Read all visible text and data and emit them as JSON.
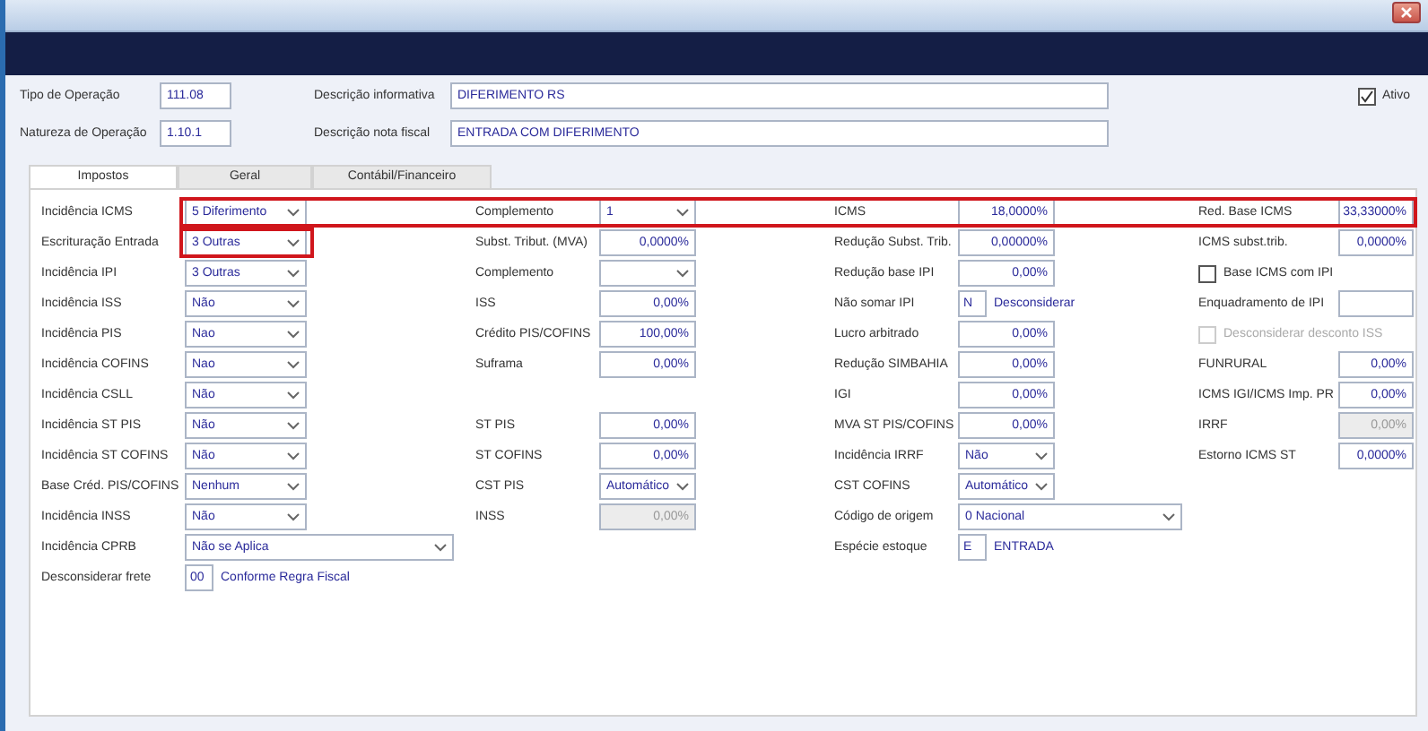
{
  "header_rows": [
    {
      "code_label": "Tipo de Operação",
      "code": "111.08",
      "description_label": "Descrição informativa",
      "description": "DIFERIMENTO RS"
    },
    {
      "code_label": "Natureza de Operação",
      "code": "1.10.1",
      "description_label": "Descrição nota fiscal",
      "description": "ENTRADA COM DIFERIMENTO"
    }
  ],
  "active": {
    "label": "Ativo",
    "checked": true
  },
  "tabs": [
    {
      "label": "Impostos",
      "selected": true
    },
    {
      "label": "Geral",
      "selected": false
    },
    {
      "label": "Contábil/Financeiro",
      "selected": false
    }
  ],
  "rows": [
    {
      "highlighted": true,
      "left": {
        "kind": "select",
        "label": "Incidência ICMS",
        "value": "5 Diferimento"
      },
      "center_left": {
        "kind": "select",
        "label": "Complemento",
        "value": "1"
      },
      "center_right": {
        "kind": "percent",
        "label": "ICMS",
        "value": "18,0000%",
        "disabled": false
      },
      "right": {
        "kind": "percent",
        "label": "Red. Base ICMS",
        "value": "33,33000%",
        "disabled": false
      }
    },
    {
      "left": {
        "kind": "select",
        "label": "Escrituração Entrada",
        "value": "3 Outras",
        "highlighted": true
      },
      "center_left": {
        "kind": "percent",
        "label": "Subst. Tribut. (MVA)",
        "value": "0,0000%",
        "disabled": false
      },
      "center_right": {
        "kind": "percent",
        "label": "Redução Subst. Trib.",
        "value": "0,00000%",
        "disabled": false
      },
      "right": {
        "kind": "percent",
        "label": "ICMS subst.trib.",
        "value": "0,0000%",
        "disabled": false
      }
    },
    {
      "left": {
        "kind": "select",
        "label": "Incidência IPI",
        "value": "3 Outras"
      },
      "center_left": {
        "kind": "select",
        "label": "Complemento"
      },
      "center_right": {
        "kind": "percent",
        "label": "Redução base IPI",
        "value": "0,00%",
        "disabled": false
      },
      "right": {
        "kind": "checkbox",
        "label": "Base ICMS com IPI",
        "checked": false,
        "disabled": false
      }
    },
    {
      "left": {
        "kind": "select",
        "label": "Incidência ISS",
        "value": "Não"
      },
      "center_left": {
        "kind": "percent",
        "label": "ISS",
        "value": "0,00%",
        "disabled": false
      },
      "center_right": {
        "kind": "code",
        "label": "Não somar IPI",
        "code": "N",
        "text": "Desconsiderar"
      },
      "right": {
        "kind": "text",
        "label": "Enquadramento de IPI"
      }
    },
    {
      "left": {
        "kind": "select",
        "label": "Incidência PIS",
        "value": "Nao"
      },
      "center_left": {
        "kind": "percent",
        "label": "Crédito PIS/COFINS",
        "value": "100,00%",
        "disabled": false
      },
      "center_right": {
        "kind": "percent",
        "label": "Lucro arbitrado",
        "value": "0,00%",
        "disabled": false
      },
      "right": {
        "kind": "checkbox",
        "label": "Desconsiderar desconto ISS",
        "checked": false,
        "disabled": true
      }
    },
    {
      "left": {
        "kind": "select",
        "label": "Incidência COFINS",
        "value": "Nao"
      },
      "center_left": {
        "kind": "percent",
        "label": "Suframa",
        "value": "0,00%",
        "disabled": false
      },
      "center_right": {
        "kind": "percent",
        "label": "Redução SIMBAHIA",
        "value": "0,00%",
        "disabled": false
      },
      "right": {
        "kind": "percent",
        "label": "FUNRURAL",
        "value": "0,00%",
        "disabled": false
      }
    },
    {
      "left": {
        "kind": "select",
        "label": "Incidência CSLL",
        "value": "Não"
      },
      "center_right": {
        "kind": "percent",
        "label": "IGI",
        "value": "0,00%",
        "disabled": false
      },
      "right": {
        "kind": "percent",
        "label": "ICMS IGI/ICMS Imp. PR",
        "value": "0,00%",
        "disabled": false
      }
    },
    {
      "left": {
        "kind": "select",
        "label": "Incidência ST PIS",
        "value": "Não"
      },
      "center_left": {
        "kind": "percent",
        "label": "ST PIS",
        "value": "0,00%",
        "disabled": false
      },
      "center_right": {
        "kind": "percent",
        "label": "MVA ST PIS/COFINS",
        "value": "0,00%",
        "disabled": false
      },
      "right": {
        "kind": "percent",
        "label": "IRRF",
        "value": "0,00%",
        "disabled": true
      }
    },
    {
      "left": {
        "kind": "select",
        "label": "Incidência ST COFINS",
        "value": "Não"
      },
      "center_left": {
        "kind": "percent",
        "label": "ST COFINS",
        "value": "0,00%",
        "disabled": false
      },
      "center_right": {
        "kind": "select",
        "label": "Incidência IRRF",
        "value": "Não"
      },
      "right": {
        "kind": "percent",
        "label": "Estorno ICMS ST",
        "value": "0,0000%",
        "disabled": false
      }
    },
    {
      "left": {
        "kind": "select",
        "label": "Base Créd. PIS/COFINS",
        "value": "Nenhum"
      },
      "center_left": {
        "kind": "select",
        "label": "CST PIS",
        "value": "Automático"
      },
      "center_right": {
        "kind": "select",
        "label": "CST COFINS",
        "value": "Automático"
      }
    },
    {
      "left": {
        "kind": "select",
        "label": "Incidência INSS",
        "value": "Não"
      },
      "center_left": {
        "kind": "percent",
        "label": "INSS",
        "value": "0,00%",
        "disabled": true
      },
      "center_right": {
        "kind": "wide_select",
        "label": "Código de origem",
        "value": "0 Nacional"
      }
    },
    {
      "left": {
        "kind": "wide_select",
        "label": "Incidência CPRB",
        "value": "Não se Aplica"
      },
      "center_right": {
        "kind": "code",
        "label": "Espécie estoque",
        "code": "E",
        "text": "ENTRADA"
      }
    },
    {
      "left": {
        "kind": "code",
        "label": "Desconsiderar frete",
        "code": "00",
        "text": "Conforme Regra Fiscal"
      }
    }
  ]
}
